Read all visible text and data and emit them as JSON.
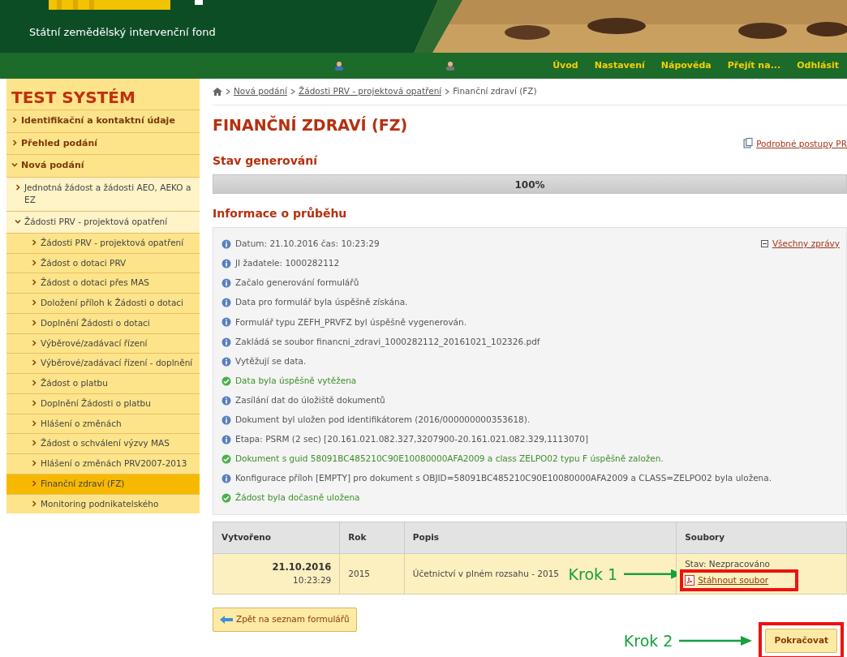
{
  "header": {
    "subtitle": "Státní zemědělský intervenční fond"
  },
  "nav": {
    "links": [
      {
        "label": "Úvod"
      },
      {
        "label": "Nastavení"
      },
      {
        "label": "Nápověda"
      },
      {
        "label": "Přejít na..."
      },
      {
        "label": "Odhlásit"
      }
    ]
  },
  "sidebar": {
    "title": "TEST SYSTÉM",
    "items": [
      {
        "label": "Identifikační a kontaktní údaje",
        "expanded": false,
        "selected": false
      },
      {
        "label": "Přehled podání",
        "expanded": false,
        "selected": false
      },
      {
        "label": "Nová podání",
        "expanded": true,
        "selected": false,
        "children": [
          {
            "label": "Jednotná žádost a žádosti AEO, AEKO a EZ",
            "expanded": false,
            "selected": false
          },
          {
            "label": "Žádosti PRV - projektová opatření",
            "expanded": true,
            "selected": false,
            "children": [
              {
                "label": "Žádosti PRV - projektová opatření",
                "selected": false
              },
              {
                "label": "Žádost o dotaci PRV",
                "selected": false
              },
              {
                "label": "Žádost o dotaci přes MAS",
                "selected": false
              },
              {
                "label": "Doložení příloh k Žádosti o dotaci",
                "selected": false
              },
              {
                "label": "Doplnění Žádosti o dotaci",
                "selected": false
              },
              {
                "label": "Výběrové/zadávací řízení",
                "selected": false
              },
              {
                "label": "Výběrové/zadávací řízení - doplnění",
                "selected": false
              },
              {
                "label": "Žádost o platbu",
                "selected": false
              },
              {
                "label": "Doplnění Žádosti o platbu",
                "selected": false
              },
              {
                "label": "Hlášení o změnách",
                "selected": false
              },
              {
                "label": "Žádost o schválení výzvy MAS",
                "selected": false
              },
              {
                "label": "Hlášení o změnách PRV2007-2013",
                "selected": false
              },
              {
                "label": "Finanční zdraví (FZ)",
                "selected": true
              },
              {
                "label": "Monitoring podnikatelského",
                "selected": false
              }
            ]
          }
        ]
      }
    ]
  },
  "breadcrumb": [
    {
      "label": "Nová podání",
      "kind": "link"
    },
    {
      "label": "Žádosti PRV - projektová opatření",
      "kind": "link"
    },
    {
      "label": "Finanční zdraví (FZ)",
      "kind": "current"
    }
  ],
  "title": "FINANČNÍ ZDRAVÍ (FZ)",
  "help_link": "Podrobné postupy PR",
  "progress": {
    "heading": "Stav generování",
    "level": 1,
    "reading": "100%"
  },
  "log": {
    "heading": "Informace o průběhu",
    "toggle": "Všechny zprávy",
    "messages": [
      {
        "kind": "info",
        "text": "Datum: 21.10.2016 čas: 10:23:29"
      },
      {
        "kind": "info",
        "text": "JI žadatele: 1000282112"
      },
      {
        "kind": "info",
        "text": "Začalo generování formulářů"
      },
      {
        "kind": "info",
        "text": "Data pro formulář byla úspěšně získána."
      },
      {
        "kind": "info",
        "text": "Formulář typu ZEFH_PRVFZ byl úspěšně vygenerován."
      },
      {
        "kind": "info",
        "text": "Zakládá se soubor financni_zdravi_1000282112_20161021_102326.pdf"
      },
      {
        "kind": "info",
        "text": "Vytěžují se data."
      },
      {
        "kind": "success",
        "text": "Data byla úspěšně vytěžena"
      },
      {
        "kind": "info",
        "text": "Zasílání dat do úložiště dokumentů"
      },
      {
        "kind": "info",
        "text": "Dokument byl uložen pod identifikátorem (2016/000000000353618)."
      },
      {
        "kind": "info",
        "text": "Etapa: PSRM (2 sec) [20.161.021.082.327,3207900-20.161.021.082.329,1113070]"
      },
      {
        "kind": "success",
        "text": "Dokument s guid 58091BC485210C90E10080000AFA2009 a class ZELPO02 typu F úspěšně založen."
      },
      {
        "kind": "info",
        "text": "Konfigurace příloh [EMPTY] pro dokument s OBJID=58091BC485210C90E10080000AFA2009 a CLASS=ZELPO02 byla uložena."
      },
      {
        "kind": "success",
        "text": "Žádost byla dočasně uložena"
      }
    ]
  },
  "table": {
    "columns": [
      "Vytvořeno",
      "Rok",
      "Popis",
      "Soubory"
    ],
    "rows": [
      {
        "date": "21.10.2016",
        "time": "10:23:29",
        "year": "2015",
        "description": "Účetnictví v plném rozsahu - 2015",
        "status": "Stav: Nezpracováno",
        "file_link": "Stáhnout soubor"
      }
    ]
  },
  "back_button": "Zpět na seznam formulářů",
  "continue_button": "Pokračovat",
  "annotations": [
    {
      "label": "Krok 1"
    },
    {
      "label": "Krok 2"
    }
  ]
}
